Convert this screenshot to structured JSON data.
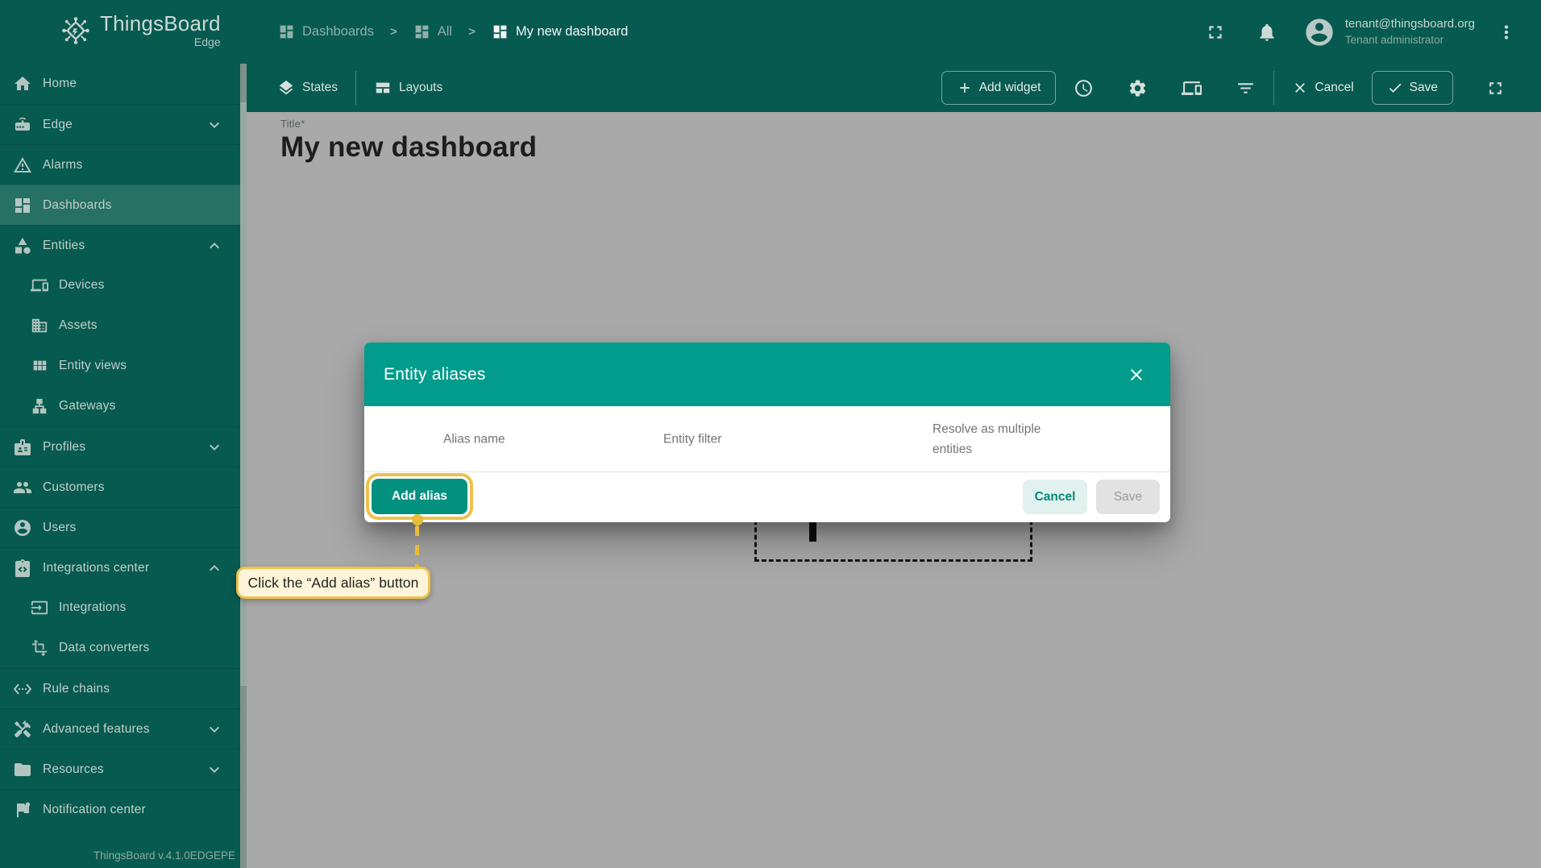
{
  "header": {
    "logo_title": "ThingsBoard",
    "logo_subtitle": "Edge",
    "breadcrumbs": [
      {
        "key": "dashboards",
        "label": "Dashboards",
        "icon": "dashboard-icon",
        "active": false
      },
      {
        "key": "all",
        "label": "All",
        "icon": "dashboard-icon",
        "active": false
      },
      {
        "key": "my-new-dashboard",
        "label": "My new dashboard",
        "icon": "dashboard-icon",
        "active": true
      }
    ],
    "user_email": "tenant@thingsboard.org",
    "user_role": "Tenant administrator"
  },
  "sidebar": {
    "items": [
      {
        "key": "home",
        "icon": "home-icon",
        "label": "Home",
        "sub": false,
        "selected": false,
        "chevron": null
      },
      {
        "key": "edge",
        "icon": "edge-router-icon",
        "label": "Edge",
        "sub": false,
        "selected": false,
        "chevron": "down"
      },
      {
        "key": "alarms",
        "icon": "alarms-warning-icon",
        "label": "Alarms",
        "sub": false,
        "selected": false,
        "chevron": null
      },
      {
        "key": "dashboards",
        "icon": "dashboards-icon",
        "label": "Dashboards",
        "sub": false,
        "selected": true,
        "chevron": null
      },
      {
        "key": "entities",
        "icon": "entities-icon",
        "label": "Entities",
        "sub": false,
        "selected": false,
        "chevron": "up"
      },
      {
        "key": "devices",
        "icon": "devices-icon",
        "label": "Devices",
        "sub": true,
        "selected": false,
        "chevron": null
      },
      {
        "key": "assets",
        "icon": "assets-icon",
        "label": "Assets",
        "sub": true,
        "selected": false,
        "chevron": null
      },
      {
        "key": "entity-views",
        "icon": "entity-views-icon",
        "label": "Entity views",
        "sub": true,
        "selected": false,
        "chevron": null
      },
      {
        "key": "gateways",
        "icon": "gateways-icon",
        "label": "Gateways",
        "sub": true,
        "selected": false,
        "chevron": null
      },
      {
        "key": "profiles",
        "icon": "profiles-icon",
        "label": "Profiles",
        "sub": false,
        "selected": false,
        "chevron": "down"
      },
      {
        "key": "customers",
        "icon": "customers-icon",
        "label": "Customers",
        "sub": false,
        "selected": false,
        "chevron": null
      },
      {
        "key": "users",
        "icon": "users-icon",
        "label": "Users",
        "sub": false,
        "selected": false,
        "chevron": null
      },
      {
        "key": "integrations-center",
        "icon": "integrations-center-icon",
        "label": "Integrations center",
        "sub": false,
        "selected": false,
        "chevron": "up"
      },
      {
        "key": "integrations",
        "icon": "integrations-icon",
        "label": "Integrations",
        "sub": true,
        "selected": false,
        "chevron": null
      },
      {
        "key": "data-converters",
        "icon": "data-converters-icon",
        "label": "Data converters",
        "sub": true,
        "selected": false,
        "chevron": null
      },
      {
        "key": "rule-chains",
        "icon": "rule-chains-icon",
        "label": "Rule chains",
        "sub": false,
        "selected": false,
        "chevron": null
      },
      {
        "key": "advanced-features",
        "icon": "advanced-features-icon",
        "label": "Advanced features",
        "sub": false,
        "selected": false,
        "chevron": "down"
      },
      {
        "key": "resources",
        "icon": "resources-icon",
        "label": "Resources",
        "sub": false,
        "selected": false,
        "chevron": "down"
      },
      {
        "key": "notification-center",
        "icon": "notification-center-icon",
        "label": "Notification center",
        "sub": false,
        "selected": false,
        "chevron": null
      }
    ],
    "version": "ThingsBoard v.4.1.0EDGEPE"
  },
  "toolbar": {
    "states_label": "States",
    "layouts_label": "Layouts",
    "add_widget_label": "Add widget",
    "cancel_label": "Cancel",
    "save_label": "Save"
  },
  "canvas": {
    "title_label": "Title*",
    "title": "My new dashboard"
  },
  "dialog": {
    "title": "Entity aliases",
    "columns": [
      "Alias name",
      "Entity filter",
      "Resolve as multiple entities"
    ],
    "add_alias_label": "Add alias",
    "cancel_label": "Cancel",
    "save_label": "Save"
  },
  "tooltip": {
    "text": "Click the “Add alias” button"
  },
  "colors": {
    "teal-dark": "#075a50",
    "teal-row-selected": "#267064",
    "dialog-header-teal": "#019c8c",
    "button-teal": "#02907f",
    "accent-teal": "#00897b",
    "gold": "#eec14d",
    "gold-dark": "#e9bb3a",
    "tooltip-bg": "#fdf4da",
    "canvas-gray": "#a9a9a9"
  }
}
